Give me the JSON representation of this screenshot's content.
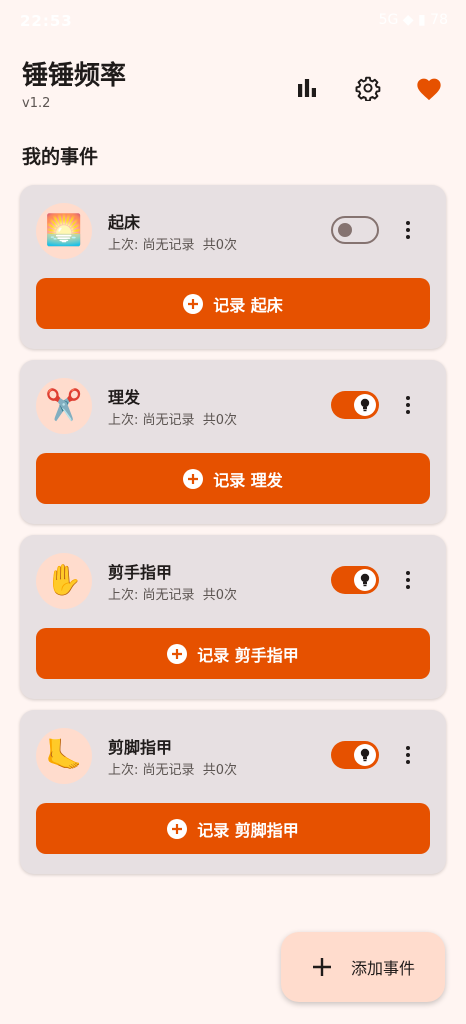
{
  "status_bar": {
    "time": "22:53",
    "right": "5G ◆ ▮ 78"
  },
  "app": {
    "title": "锤锤频率",
    "version": "v1.2"
  },
  "header_icons": [
    "bar-chart-icon",
    "gear-icon",
    "heart-icon"
  ],
  "section_title": "我的事件",
  "events": [
    {
      "name": "起床",
      "icon": "🌅",
      "meta": "上次: 尚无记录  共0次",
      "enabled": false,
      "record_label": "记录 起床"
    },
    {
      "name": "理发",
      "icon": "✂️",
      "meta": "上次: 尚无记录  共0次",
      "enabled": true,
      "record_label": "记录 理发"
    },
    {
      "name": "剪手指甲",
      "icon": "✋",
      "meta": "上次: 尚无记录  共0次",
      "enabled": true,
      "record_label": "记录 剪手指甲"
    },
    {
      "name": "剪脚指甲",
      "icon": "🦶",
      "meta": "上次: 尚无记录  共0次",
      "enabled": true,
      "record_label": "记录 剪脚指甲"
    }
  ],
  "fab": {
    "label": "添加事件"
  },
  "colors": {
    "accent": "#E65100",
    "background": "#FFF5F2",
    "card": "#E7E0E2",
    "avatar_bg": "#FFDCCD",
    "heart": "#E65100"
  }
}
